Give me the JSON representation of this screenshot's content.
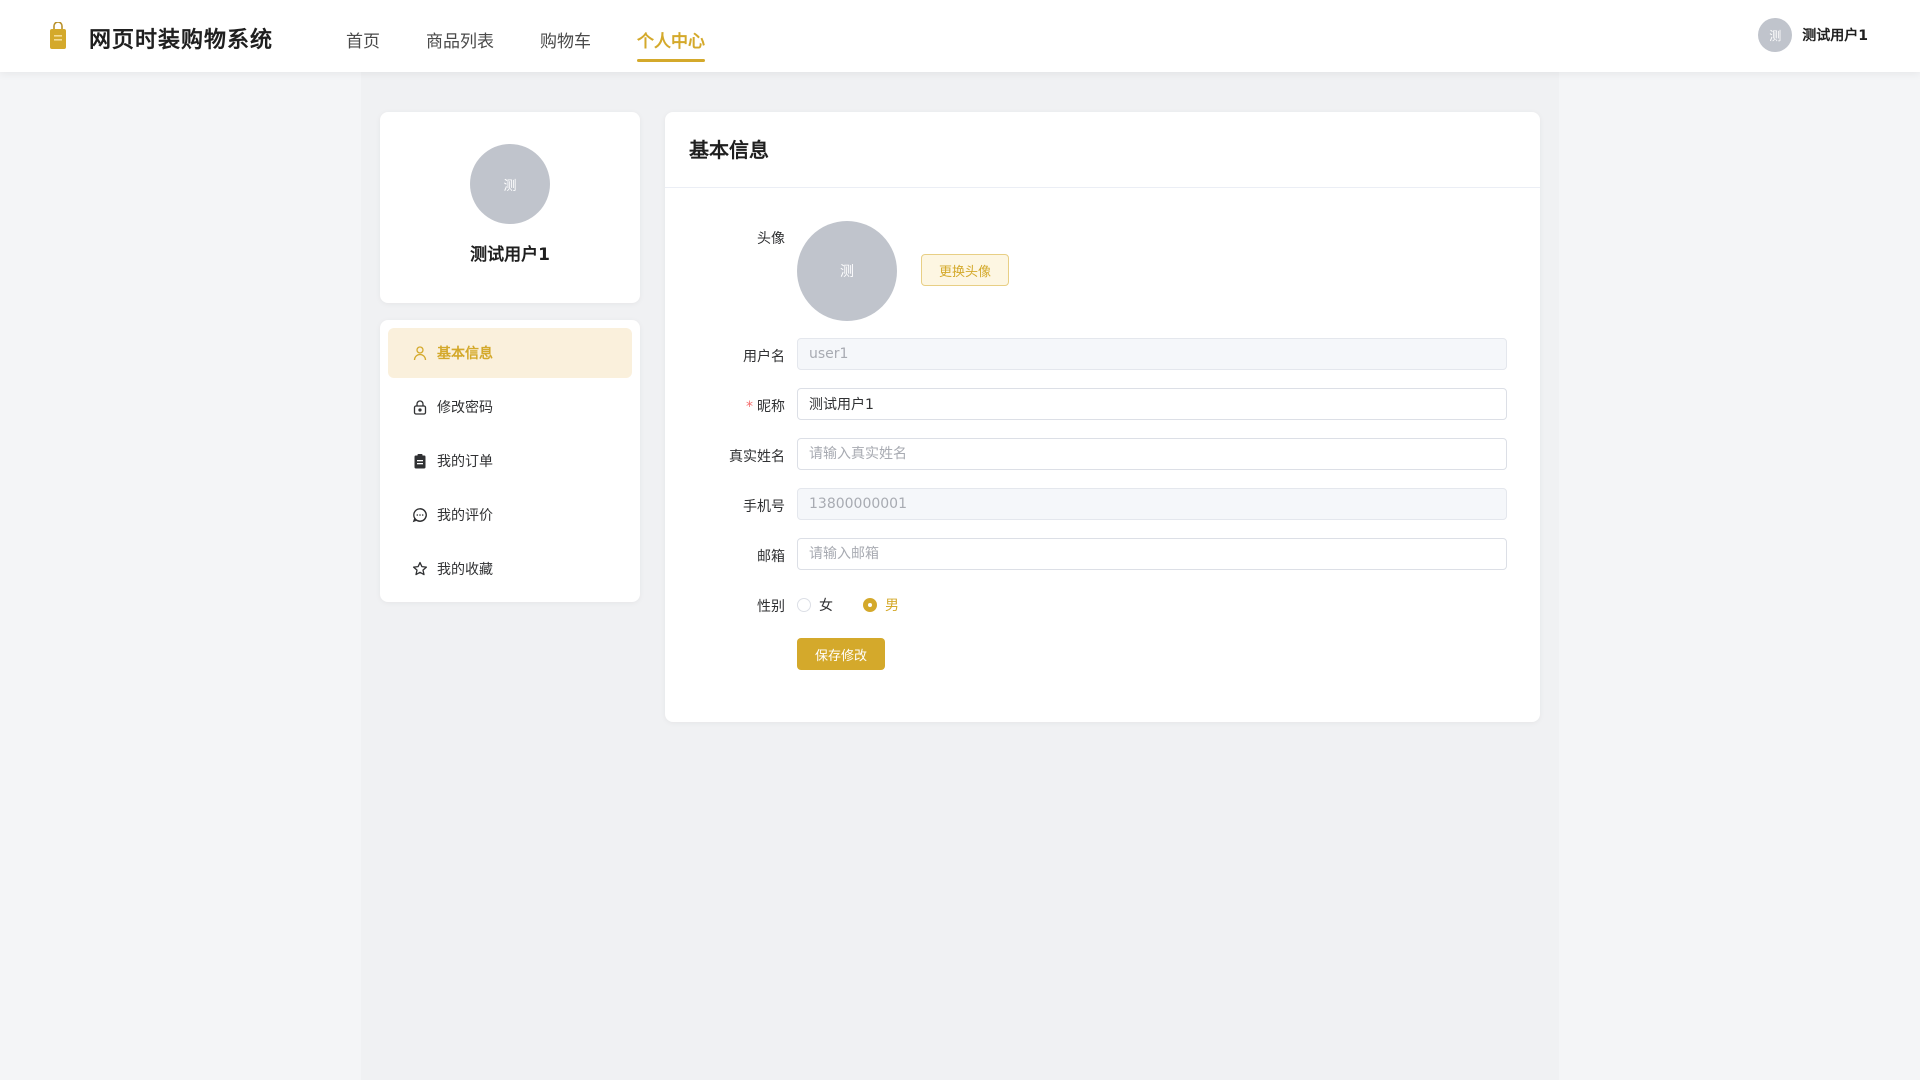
{
  "header": {
    "app_title": "网页时装购物系统",
    "nav": [
      "首页",
      "商品列表",
      "购物车",
      "个人中心"
    ],
    "active_nav": "个人中心",
    "user": {
      "avatar_text": "测",
      "name": "测试用户1"
    }
  },
  "profile": {
    "avatar_text": "测",
    "name": "测试用户1"
  },
  "menu": {
    "items": [
      {
        "label": "基本信息",
        "icon": "user-icon",
        "active": true
      },
      {
        "label": "修改密码",
        "icon": "lock-icon"
      },
      {
        "label": "我的订单",
        "icon": "clipboard-icon"
      },
      {
        "label": "我的评价",
        "icon": "chat-icon"
      },
      {
        "label": "我的收藏",
        "icon": "star-icon"
      }
    ]
  },
  "form": {
    "title": "基本信息",
    "avatar": {
      "label": "头像",
      "avatar_text": "测",
      "change_button": "更换头像"
    },
    "username": {
      "label": "用户名",
      "value": "user1",
      "disabled": true
    },
    "nickname": {
      "label": "昵称",
      "required_mark": "*",
      "value": "测试用户1"
    },
    "real_name": {
      "label": "真实姓名",
      "value": "",
      "placeholder": "请输入真实姓名"
    },
    "phone": {
      "label": "手机号",
      "value": "13800000001",
      "disabled": true
    },
    "email": {
      "label": "邮箱",
      "value": "",
      "placeholder": "请输入邮箱"
    },
    "gender": {
      "label": "性别",
      "options": [
        "女",
        "男"
      ],
      "selected": "男"
    },
    "save_button": "保存修改"
  },
  "colors": {
    "accent": "#d4a92b",
    "avatar_bg": "#c0c4cc",
    "menu_active_bg": "#faf0dc"
  }
}
